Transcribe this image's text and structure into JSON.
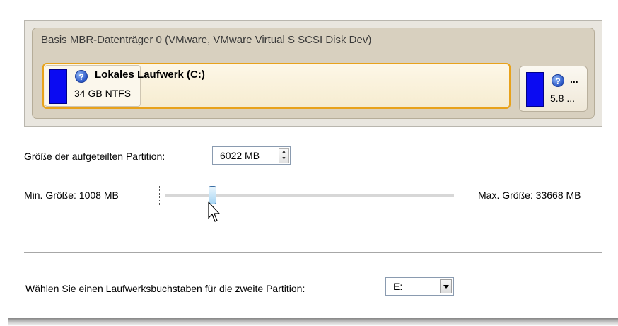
{
  "disk": {
    "title": "Basis MBR-Datenträger 0 (VMware, VMware Virtual S SCSI Disk Dev)",
    "partitions": [
      {
        "name": "Lokales Laufwerk (C:)",
        "info": "34 GB NTFS",
        "bar_color": "#0b0bf2",
        "selected": true
      },
      {
        "name": "...",
        "info": "5.8 ...",
        "bar_color": "#0b0bf2",
        "selected": false
      }
    ],
    "help_icon": "question-icon"
  },
  "size": {
    "label": "Größe der aufgeteilten Partition:",
    "value": "6022 MB"
  },
  "slider": {
    "min_label": "Min. Größe: 1008 MB",
    "max_label": "Max. Größe: 33668 MB",
    "min_mb": 1008,
    "max_mb": 33668,
    "value_mb": 6022
  },
  "drive_letter": {
    "label": "Wählen Sie einen Laufwerksbuchstaben für die zweite Partition:",
    "value": "E:"
  },
  "colors": {
    "selection_border": "#e8a21b",
    "partition_bar": "#0b0bf2"
  }
}
